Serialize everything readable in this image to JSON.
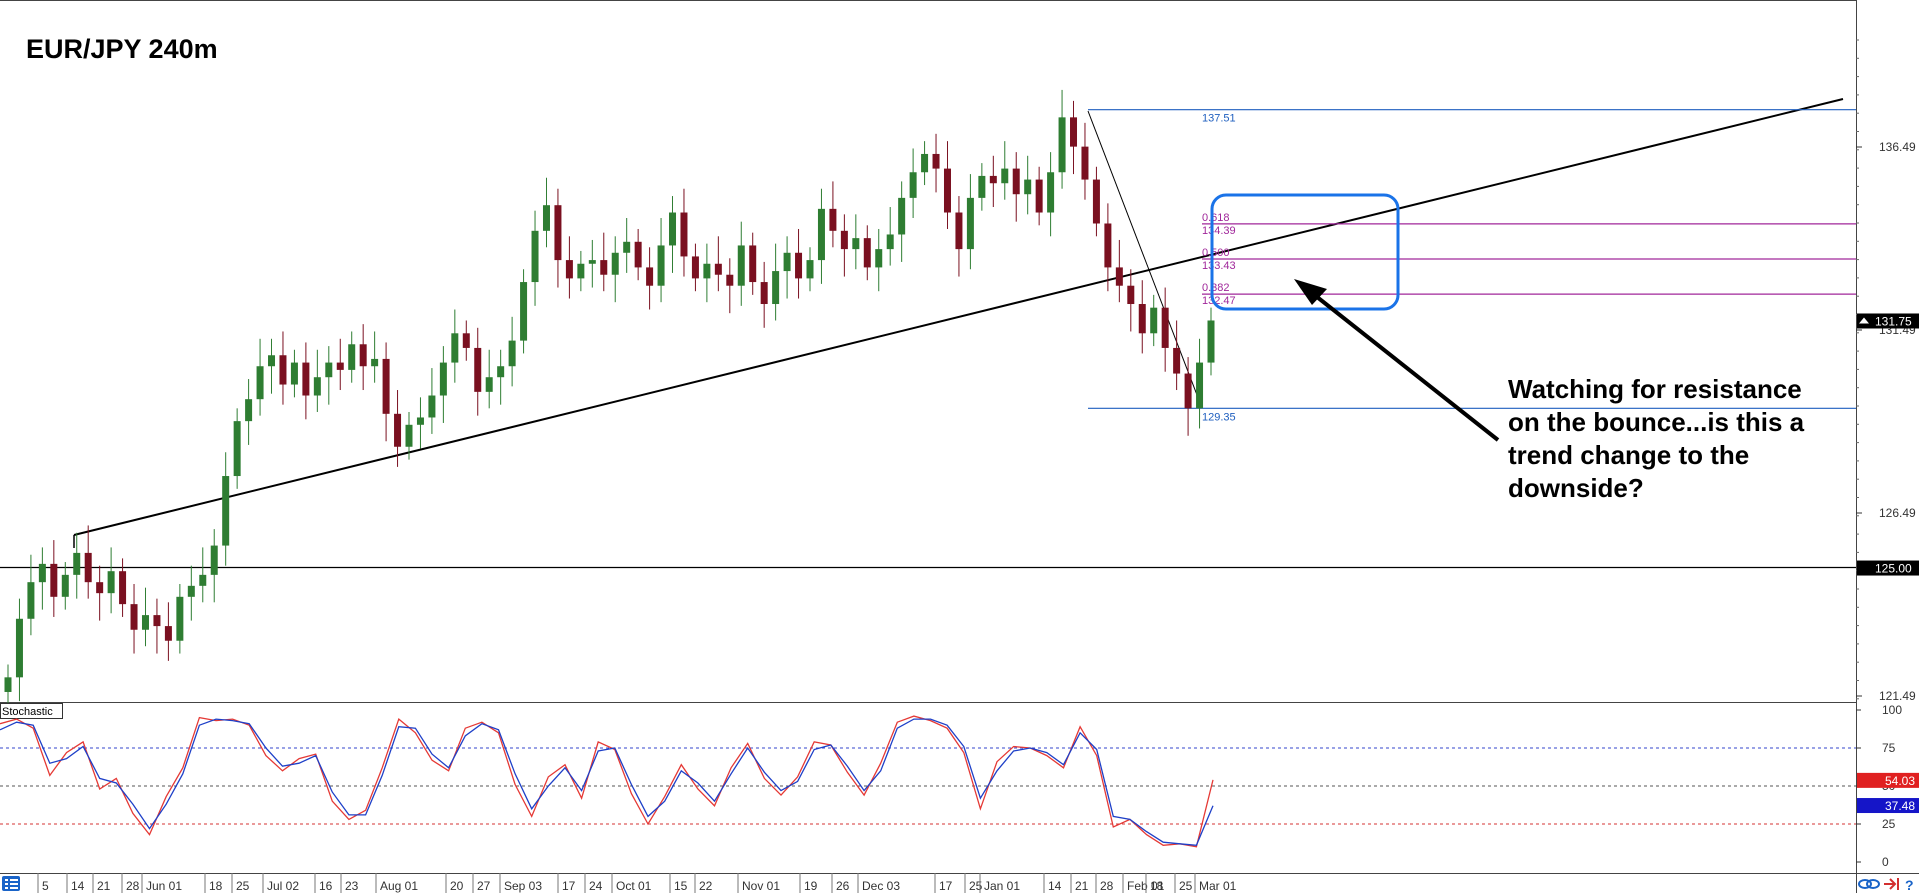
{
  "chart_data": [
    {
      "type": "candlestick",
      "title": "EUR/JPY 240m",
      "annotation": "Watching for resistance on the bounce...is this a trend change to the downside?",
      "price_axis": {
        "ticks": [
          "136.49",
          "131.49",
          "126.49",
          "121.49"
        ],
        "range": [
          121.0,
          137.9
        ]
      },
      "time_axis": {
        "ticks": [
          "5",
          "14",
          "21",
          "28",
          "Jun 01",
          "18",
          "25",
          "Jul 02",
          "16",
          "23",
          "Aug 01",
          "20",
          "27",
          "Sep 03",
          "17",
          "24",
          "Oct 01",
          "15",
          "22",
          "Nov 01",
          "19",
          "26",
          "Dec 03",
          "17",
          "25",
          "Jan 01",
          "14",
          "21",
          "28",
          "Feb 01",
          "18",
          "25",
          "Mar 01"
        ]
      },
      "close_series": [
        122.0,
        123.6,
        124.6,
        125.1,
        124.2,
        124.8,
        125.4,
        124.6,
        124.3,
        124.9,
        124.0,
        123.3,
        123.7,
        123.4,
        123.0,
        124.2,
        124.5,
        124.8,
        125.6,
        127.5,
        129.0,
        129.6,
        130.5,
        130.8,
        130.0,
        130.6,
        129.7,
        130.2,
        130.6,
        130.4,
        131.1,
        130.5,
        130.7,
        129.2,
        128.3,
        128.9,
        129.1,
        129.7,
        130.6,
        131.4,
        131.0,
        129.8,
        130.2,
        130.5,
        131.2,
        132.8,
        134.2,
        134.9,
        133.4,
        132.9,
        133.3,
        133.4,
        133.0,
        133.6,
        133.9,
        133.2,
        132.7,
        133.8,
        134.7,
        133.5,
        132.9,
        133.3,
        133.0,
        132.7,
        133.8,
        132.8,
        132.2,
        133.1,
        133.6,
        132.9,
        133.4,
        134.8,
        134.2,
        133.7,
        134.0,
        133.2,
        133.7,
        134.1,
        135.1,
        135.8,
        136.3,
        135.9,
        134.7,
        133.7,
        135.1,
        135.7,
        135.5,
        135.9,
        135.2,
        135.6,
        134.7,
        135.8,
        137.3,
        136.5,
        135.6,
        134.4,
        133.2,
        132.7,
        132.2,
        131.4,
        132.1,
        131.0,
        130.3,
        129.35,
        130.6,
        131.75
      ],
      "horizontal_levels": [
        "137.51",
        "129.35",
        "125.00"
      ],
      "fibonacci": [
        {
          "ratio": "0.618",
          "price": "134.39"
        },
        {
          "ratio": "0.500",
          "price": "133.43"
        },
        {
          "ratio": "0.382",
          "price": "132.47"
        }
      ],
      "price_tags": [
        {
          "label": "131.75",
          "color": "#000000"
        },
        {
          "label": "125.00",
          "color": "#000000"
        }
      ],
      "colors": {
        "bull": "#2e7d32",
        "bear": "#7a1020",
        "trendline": "#000000",
        "level": "#1f5fbf",
        "fib": "#a0279a",
        "box": "#1a73e8"
      }
    },
    {
      "type": "line",
      "title": "Stochastic",
      "y_ticks": [
        "100",
        "75",
        "50",
        "25",
        "0"
      ],
      "levels": [
        75,
        50,
        25
      ],
      "series": [
        {
          "name": "",
          "color": "#e53935",
          "values": [
            91,
            94,
            88,
            57,
            72,
            79,
            48,
            55,
            32,
            18,
            43,
            62,
            95,
            93,
            94,
            90,
            70,
            60,
            68,
            71,
            40,
            28,
            34,
            62,
            94,
            85,
            67,
            60,
            88,
            92,
            85,
            51,
            30,
            56,
            64,
            42,
            79,
            74,
            45,
            25,
            43,
            64,
            48,
            37,
            62,
            78,
            55,
            44,
            56,
            79,
            77,
            59,
            44,
            65,
            92,
            96,
            93,
            88,
            72,
            35,
            66,
            76,
            75,
            70,
            62,
            89,
            70,
            23,
            28,
            18,
            11,
            12,
            10,
            54
          ]
        },
        {
          "name": "",
          "color": "#1e40c8",
          "values": [
            87,
            92,
            90,
            65,
            68,
            76,
            55,
            52,
            38,
            22,
            38,
            58,
            90,
            94,
            93,
            91,
            75,
            63,
            65,
            70,
            46,
            31,
            31,
            57,
            89,
            88,
            71,
            62,
            83,
            91,
            87,
            58,
            35,
            50,
            62,
            47,
            73,
            75,
            51,
            30,
            40,
            60,
            52,
            40,
            58,
            75,
            59,
            47,
            53,
            74,
            77,
            63,
            47,
            60,
            88,
            94,
            94,
            90,
            76,
            42,
            60,
            73,
            75,
            72,
            64,
            85,
            74,
            30,
            28,
            20,
            13,
            12,
            11,
            37
          ]
        }
      ],
      "value_tags": [
        {
          "label": "54.03",
          "color": "#e02020"
        },
        {
          "label": "37.48",
          "color": "#1515c8"
        }
      ]
    }
  ]
}
